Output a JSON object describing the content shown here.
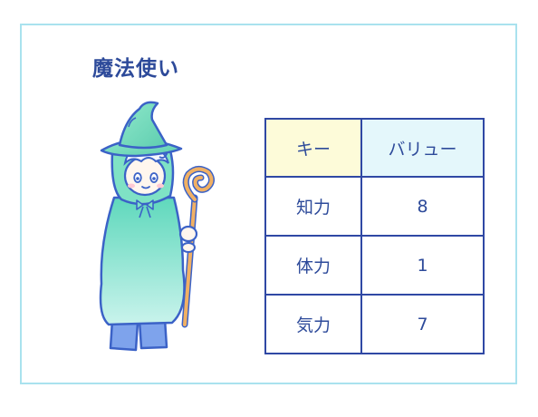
{
  "title": "魔法使い",
  "table": {
    "headers": {
      "key": "キー",
      "value": "バリュー"
    },
    "rows": [
      {
        "key": "知力",
        "value": "8"
      },
      {
        "key": "体力",
        "value": "1"
      },
      {
        "key": "気力",
        "value": "7"
      }
    ]
  },
  "colors": {
    "frame": "#a9e2ee",
    "text": "#2d4a9a",
    "table_border": "#2f48a4",
    "key_header_bg": "#fdfbd9",
    "value_header_bg": "#e4f7fb"
  },
  "illustration": {
    "icon": "wizard-icon"
  }
}
